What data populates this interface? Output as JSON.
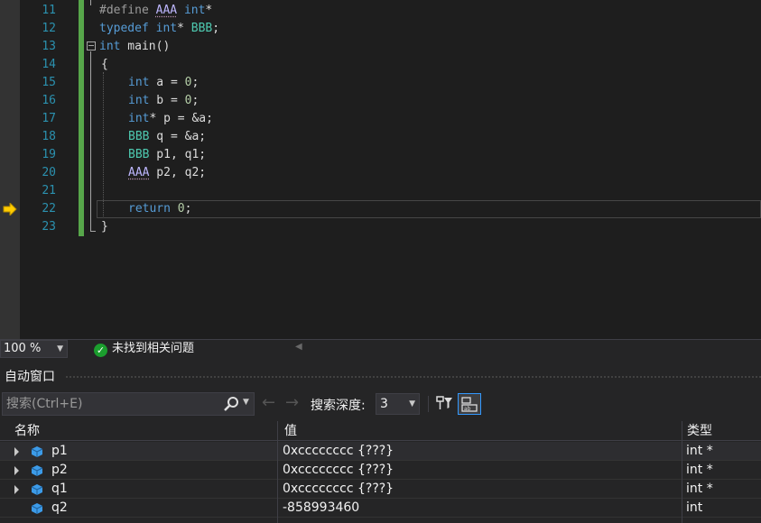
{
  "editor": {
    "lines": [
      {
        "num": "11"
      },
      {
        "num": "12"
      },
      {
        "num": "13"
      },
      {
        "num": "14"
      },
      {
        "num": "15"
      },
      {
        "num": "16"
      },
      {
        "num": "17"
      },
      {
        "num": "18"
      },
      {
        "num": "19"
      },
      {
        "num": "20"
      },
      {
        "num": "21"
      },
      {
        "num": "22"
      },
      {
        "num": "23"
      }
    ],
    "code": {
      "l11_define": "#define ",
      "l11_macro": "AAA",
      "l11_int": "int",
      "l11_rest": "*",
      "l12_typedef": "typedef ",
      "l12_int": "int",
      "l12_rest": "* ",
      "l12_bbb": "BBB",
      "l12_semi": ";",
      "l13_int": "int",
      "l13_rest": " main()",
      "l14": "{",
      "l15_int": "int",
      "l15_rest": " a = ",
      "l15_num": "0",
      "l15_semi": ";",
      "l16_int": "int",
      "l16_rest": " b = ",
      "l16_num": "0",
      "l16_semi": ";",
      "l17_int": "int",
      "l17_rest": "* p = &a;",
      "l18_bbb": "BBB",
      "l18_rest": " q = &a;",
      "l19_bbb": "BBB",
      "l19_rest": " p1, q1;",
      "l20_aaa": "AAA",
      "l20_rest": " p2, q2;",
      "l22_return": "return",
      "l22_sp": " ",
      "l22_num": "0",
      "l22_semi": ";",
      "l23": "}"
    },
    "current_line": "22"
  },
  "status_strip": {
    "zoom": "100 %",
    "issues_text": "未找到相关问题",
    "issues_icon": "check-circle-icon"
  },
  "autos": {
    "title": "自动窗口",
    "search_placeholder": "搜索(Ctrl+E)",
    "depth_label": "搜索深度:",
    "depth_value": "3",
    "columns": {
      "name": "名称",
      "value": "值",
      "type": "类型"
    },
    "rows": [
      {
        "name": "p1",
        "value": "0xcccccccc {???}",
        "type": "int *",
        "expandable": true
      },
      {
        "name": "p2",
        "value": "0xcccccccc {???}",
        "type": "int *",
        "expandable": true
      },
      {
        "name": "q1",
        "value": "0xcccccccc {???}",
        "type": "int *",
        "expandable": true
      },
      {
        "name": "q2",
        "value": "-858993460",
        "type": "int",
        "expandable": false
      }
    ]
  },
  "colors": {
    "keyword": "#569cd6",
    "type": "#4ec9b0",
    "line_number": "#2b91af",
    "change_bar": "#57a64a",
    "exec_arrow": "#ffcc00"
  }
}
